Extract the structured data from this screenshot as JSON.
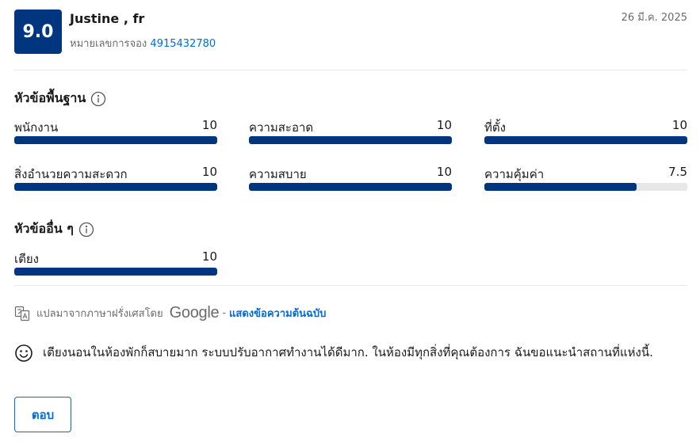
{
  "review": {
    "score": "9.0",
    "reviewer": "Justine , fr",
    "booking_label": "หมายเลขการจอง",
    "booking_number": "4915432780",
    "date": "26 มี.ค. 2025"
  },
  "basic": {
    "title": "หัวข้อพื้นฐาน",
    "items": [
      {
        "label": "พนักงาน",
        "value": "10",
        "fraction": 1.0
      },
      {
        "label": "ความสะอาด",
        "value": "10",
        "fraction": 1.0
      },
      {
        "label": "ที่ตั้ง",
        "value": "10",
        "fraction": 1.0
      },
      {
        "label": "สิ่งอำนวยความสะดวก",
        "value": "10",
        "fraction": 1.0
      },
      {
        "label": "ความสบาย",
        "value": "10",
        "fraction": 1.0
      },
      {
        "label": "ความคุ้มค่า",
        "value": "7.5",
        "fraction": 0.75
      }
    ]
  },
  "other": {
    "title": "หัวข้ออื่น ๆ",
    "items": [
      {
        "label": "เตียง",
        "value": "10",
        "fraction": 1.0
      }
    ]
  },
  "translation": {
    "text": "แปลมาจากภาษาฝรั่งเศสโดย",
    "provider": "Google",
    "separator": "-",
    "show_original": "แสดงข้อความต้นฉบับ"
  },
  "review_text": "เตียงนอนในห้องพักก็สบายมาก ระบบปรับอากาศทำงานได้ดีมาก. ในห้องมีทุกสิ่งที่คุณต้องการ ฉันขอแนะนำสถานที่แห่งนี้.",
  "reply_label": "ตอบ",
  "colors": {
    "brand": "#003580",
    "link": "#006ce4",
    "track": "#e7e7e7"
  }
}
